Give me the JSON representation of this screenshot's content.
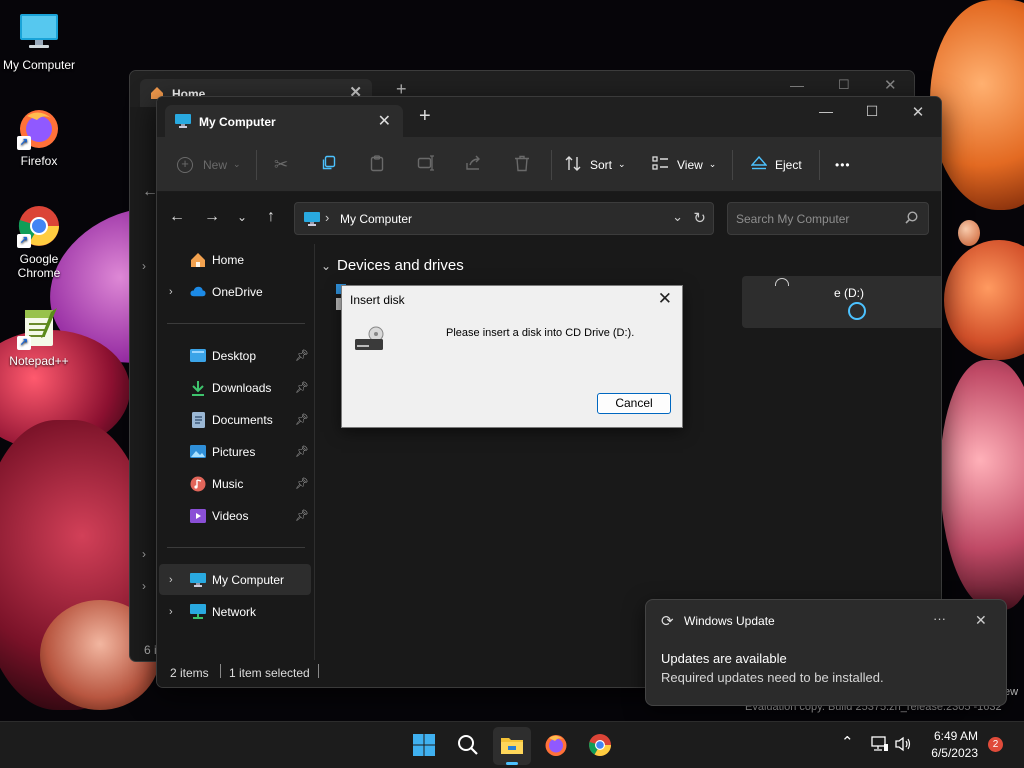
{
  "desktop": {
    "icons": [
      {
        "label": "My Computer"
      },
      {
        "label": "Firefox"
      },
      {
        "label": "Google Chrome"
      },
      {
        "label": "Notepad++"
      }
    ],
    "watermark_line1": "ew",
    "watermark_line2": "Evaluation copy. Build 25375.zn_release.2305 -1632"
  },
  "back_window": {
    "tab_label": "Home",
    "status_fragment": "6 i"
  },
  "window": {
    "tab_label": "My Computer",
    "toolbar": {
      "new_label": "New",
      "sort_label": "Sort",
      "view_label": "View",
      "eject_label": "Eject",
      "more_label": "•••"
    },
    "address": {
      "path_label": "My Computer",
      "search_placeholder": "Search My Computer"
    },
    "nav_pane": {
      "home": "Home",
      "onedrive": "OneDrive",
      "desktop": "Desktop",
      "downloads": "Downloads",
      "documents": "Documents",
      "pictures": "Pictures",
      "music": "Music",
      "videos": "Videos",
      "my_computer": "My Computer",
      "network": "Network"
    },
    "content": {
      "section_header": "Devices and drives",
      "drive_label_fragment": "e (D:)"
    },
    "status": {
      "item_count": "2 items",
      "selected": "1 item selected"
    }
  },
  "dialog": {
    "title": "Insert disk",
    "message": "Please insert a disk into CD Drive (D:).",
    "cancel_label": "Cancel"
  },
  "toast": {
    "app_name": "Windows Update",
    "more_label": "···",
    "heading": "Updates are available",
    "body": "Required updates need to be installed."
  },
  "tray": {
    "time": "6:49 AM",
    "date": "6/5/2023",
    "notification_count": "2"
  },
  "colors": {
    "accent": "#4cc2ff",
    "dialog_button_border": "#0067c0",
    "notification_badge": "#e04b3a"
  }
}
